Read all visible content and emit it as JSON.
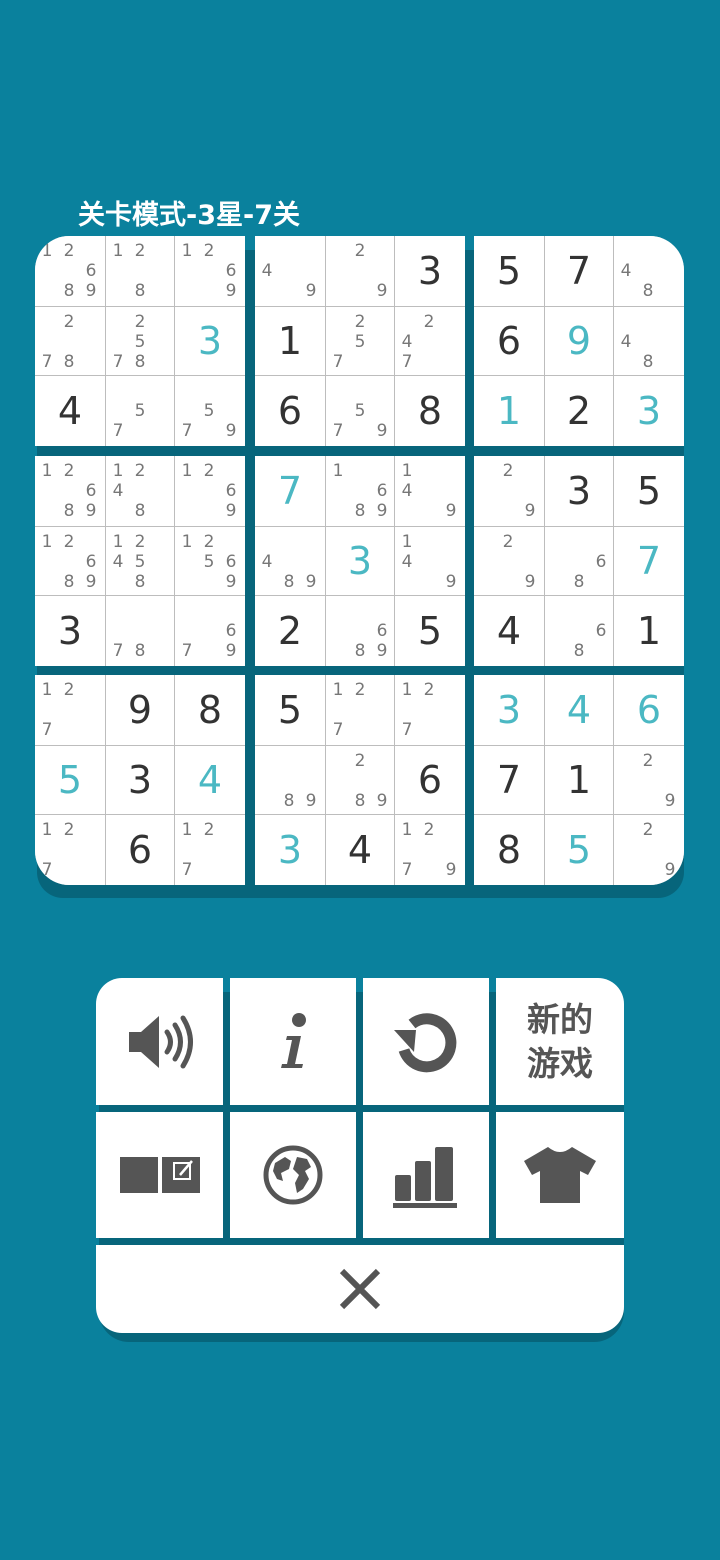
{
  "header": {
    "title": "关卡模式-3星-7关"
  },
  "board": {
    "grid": [
      [
        {
          "n": [
            1,
            2,
            6,
            8,
            9
          ]
        },
        {
          "n": [
            1,
            2,
            8
          ]
        },
        {
          "n": [
            1,
            2,
            6,
            9
          ]
        },
        {
          "n": [
            4,
            9
          ]
        },
        {
          "n": [
            2,
            9
          ]
        },
        {
          "v": 3
        },
        {
          "v": 5
        },
        {
          "v": 7
        },
        {
          "n": [
            4,
            8
          ]
        }
      ],
      [
        {
          "n": [
            2,
            7,
            8
          ]
        },
        {
          "n": [
            2,
            5,
            7,
            8
          ]
        },
        {
          "v": 3,
          "u": true
        },
        {
          "v": 1
        },
        {
          "n": [
            2,
            5,
            7
          ]
        },
        {
          "n": [
            2,
            4,
            7
          ]
        },
        {
          "v": 6
        },
        {
          "v": 9,
          "u": true
        },
        {
          "n": [
            4,
            8
          ]
        }
      ],
      [
        {
          "v": 4
        },
        {
          "n": [
            5,
            7
          ]
        },
        {
          "n": [
            5,
            7,
            9
          ]
        },
        {
          "v": 6
        },
        {
          "n": [
            5,
            7,
            9
          ]
        },
        {
          "v": 8
        },
        {
          "v": 1,
          "u": true
        },
        {
          "v": 2
        },
        {
          "v": 3,
          "u": true
        }
      ],
      [
        {
          "n": [
            1,
            2,
            6,
            8,
            9
          ]
        },
        {
          "n": [
            1,
            2,
            4,
            8
          ]
        },
        {
          "n": [
            1,
            2,
            6,
            9
          ]
        },
        {
          "v": 7,
          "u": true
        },
        {
          "n": [
            1,
            6,
            8,
            9
          ]
        },
        {
          "n": [
            1,
            4,
            9
          ]
        },
        {
          "n": [
            2,
            9
          ]
        },
        {
          "v": 3
        },
        {
          "v": 5
        }
      ],
      [
        {
          "n": [
            1,
            2,
            6,
            8,
            9
          ]
        },
        {
          "n": [
            1,
            2,
            4,
            5,
            8
          ]
        },
        {
          "n": [
            1,
            2,
            5,
            6,
            9
          ]
        },
        {
          "n": [
            4,
            8,
            9
          ]
        },
        {
          "v": 3,
          "u": true
        },
        {
          "n": [
            1,
            4,
            9
          ]
        },
        {
          "n": [
            2,
            9
          ]
        },
        {
          "n": [
            6,
            8
          ]
        },
        {
          "v": 7,
          "u": true
        }
      ],
      [
        {
          "v": 3
        },
        {
          "n": [
            7,
            8
          ]
        },
        {
          "n": [
            6,
            7,
            9
          ]
        },
        {
          "v": 2
        },
        {
          "n": [
            6,
            8,
            9
          ]
        },
        {
          "v": 5
        },
        {
          "v": 4
        },
        {
          "n": [
            6,
            8
          ]
        },
        {
          "v": 1
        }
      ],
      [
        {
          "n": [
            1,
            2,
            7
          ]
        },
        {
          "v": 9
        },
        {
          "v": 8
        },
        {
          "v": 5
        },
        {
          "n": [
            1,
            2,
            7
          ]
        },
        {
          "n": [
            1,
            2,
            7
          ]
        },
        {
          "v": 3,
          "u": true
        },
        {
          "v": 4,
          "u": true
        },
        {
          "v": 6,
          "u": true
        }
      ],
      [
        {
          "v": 5,
          "u": true
        },
        {
          "v": 3
        },
        {
          "v": 4,
          "u": true
        },
        {
          "n": [
            8,
            9
          ]
        },
        {
          "n": [
            2,
            8,
            9
          ]
        },
        {
          "v": 6
        },
        {
          "v": 7
        },
        {
          "v": 1
        },
        {
          "n": [
            2,
            9
          ]
        }
      ],
      [
        {
          "n": [
            1,
            2,
            7
          ]
        },
        {
          "v": 6
        },
        {
          "n": [
            1,
            2,
            7
          ]
        },
        {
          "v": 3,
          "u": true
        },
        {
          "v": 4
        },
        {
          "n": [
            1,
            2,
            7,
            9
          ]
        },
        {
          "v": 8
        },
        {
          "v": 5,
          "u": true
        },
        {
          "n": [
            2,
            9
          ]
        }
      ]
    ]
  },
  "controls": {
    "new_game_line1": "新的",
    "new_game_line2": "游戏"
  },
  "colors": {
    "background": "#0a819d",
    "given_digit": "#333333",
    "user_digit": "#4bb8c3",
    "note_digit": "#777777",
    "icon": "#555555"
  },
  "icons": [
    "speaker-icon",
    "info-icon",
    "restart-icon",
    "notes-toggle-icon",
    "globe-icon",
    "statistics-icon",
    "theme-shirt-icon",
    "close-icon"
  ]
}
